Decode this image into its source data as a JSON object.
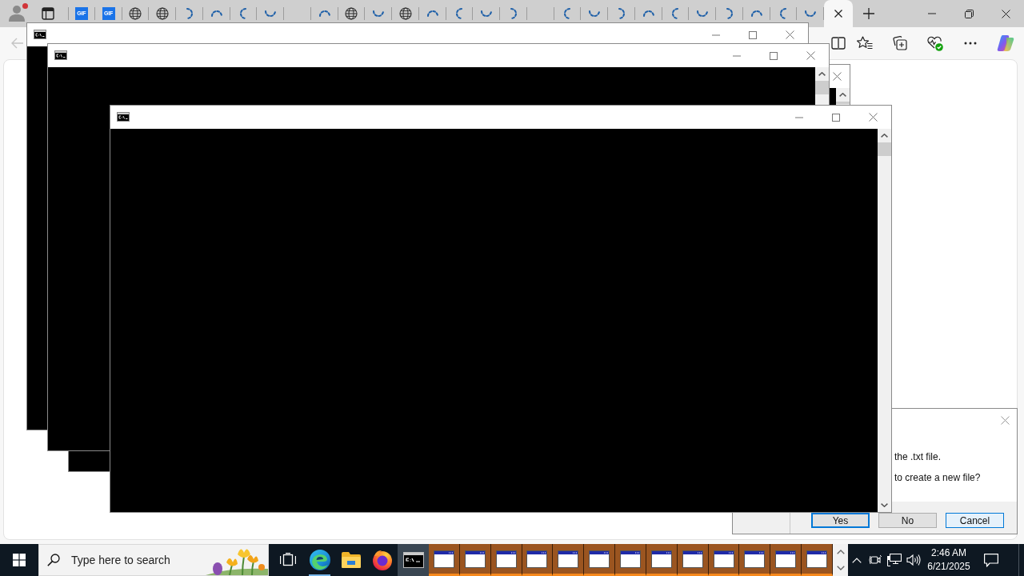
{
  "browser": {
    "profile": {
      "notification": true
    },
    "tabs": [
      {
        "kind": "gif",
        "icon_text": "GIF",
        "selected": false
      },
      {
        "kind": "gif",
        "icon_text": "GIF",
        "selected": false
      },
      {
        "kind": "globe",
        "selected": false
      },
      {
        "kind": "globe",
        "selected": false
      },
      {
        "kind": "loading",
        "selected": false
      },
      {
        "kind": "loading",
        "selected": false
      },
      {
        "kind": "loading",
        "selected": false
      },
      {
        "kind": "loading",
        "selected": false
      },
      {
        "kind": "blank",
        "selected": false
      },
      {
        "kind": "loading",
        "selected": false
      },
      {
        "kind": "globe",
        "selected": false
      },
      {
        "kind": "loading",
        "selected": false
      },
      {
        "kind": "globe",
        "selected": false
      },
      {
        "kind": "loading",
        "selected": false
      },
      {
        "kind": "loading",
        "selected": false
      },
      {
        "kind": "loading",
        "selected": false
      },
      {
        "kind": "loading",
        "selected": false
      },
      {
        "kind": "blank",
        "selected": false
      },
      {
        "kind": "loading",
        "selected": false
      },
      {
        "kind": "loading",
        "selected": false
      },
      {
        "kind": "loading",
        "selected": false
      },
      {
        "kind": "loading",
        "selected": false
      },
      {
        "kind": "loading",
        "selected": false
      },
      {
        "kind": "loading",
        "selected": false
      },
      {
        "kind": "loading",
        "selected": false
      },
      {
        "kind": "loading",
        "selected": false
      },
      {
        "kind": "loading",
        "selected": false
      },
      {
        "kind": "loading",
        "selected": false
      },
      {
        "kind": "blank",
        "selected": true
      }
    ],
    "back_disabled": true
  },
  "windows": [
    {
      "kind": "console"
    },
    {
      "kind": "console"
    },
    {
      "kind": "console"
    },
    {
      "kind": "message_box",
      "lines": [
        "the .txt file.",
        "to create a new file?"
      ],
      "buttons": [
        {
          "label": "Yes",
          "default": true,
          "hovered": false
        },
        {
          "label": "No",
          "default": false,
          "hovered": false
        },
        {
          "label": "Cancel",
          "default": false,
          "hovered": true
        }
      ]
    },
    {
      "kind": "console"
    }
  ],
  "taskbar": {
    "search": {
      "placeholder": "Type here to search"
    },
    "apps": [
      {
        "kind": "task_view",
        "running": false,
        "active": false
      },
      {
        "kind": "edge",
        "running": true,
        "active": false
      },
      {
        "kind": "file_explorer",
        "running": false,
        "active": false
      },
      {
        "kind": "firefox",
        "running": false,
        "active": false
      },
      {
        "kind": "console",
        "running": false,
        "active": true
      }
    ],
    "window_buttons": [
      {
        "flashing": true
      },
      {
        "flashing": true
      },
      {
        "flashing": true
      },
      {
        "flashing": true
      },
      {
        "flashing": true
      },
      {
        "flashing": true
      },
      {
        "flashing": true
      },
      {
        "flashing": true
      },
      {
        "flashing": true
      },
      {
        "flashing": true
      },
      {
        "flashing": true
      },
      {
        "flashing": true
      },
      {
        "flashing": true
      }
    ],
    "clock": {
      "time": "2:46 AM",
      "date": "6/21/2025"
    }
  }
}
